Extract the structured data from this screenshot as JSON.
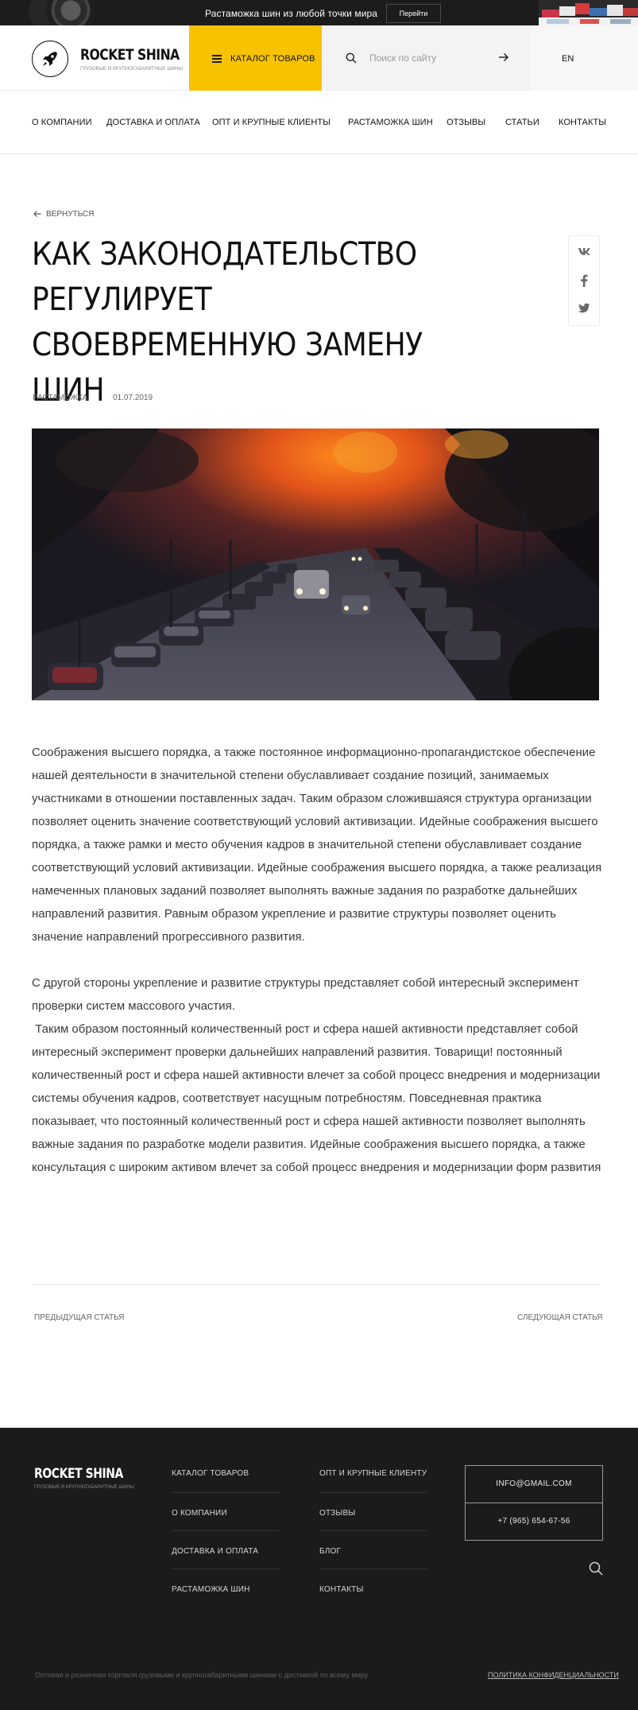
{
  "promo": {
    "text": "Растаможка шин из любой точки мира",
    "button": "Перейти"
  },
  "header": {
    "logo_name": "ROCKET SHINA",
    "logo_tagline": "ГРУЗОВЫЕ И КРУПНОГАБАРИТНЫЕ ШИНЫ",
    "catalog_label": "КАТАЛОГ ТОВАРОВ",
    "search_placeholder": "Поиск по сайту",
    "lang": "EN"
  },
  "nav": {
    "items": [
      "О КОМПАНИИ",
      "ДОСТАВКА И ОПЛАТА",
      "ОПТ И КРУПНЫЕ КЛИЕНТЫ",
      "РАСТАМОЖКА ШИН",
      "ОТЗЫВЫ",
      "СТАТЬИ",
      "КОНТАКТЫ"
    ]
  },
  "article": {
    "back_label": "ВЕРНУТЬСЯ",
    "title": "КАК ЗАКОНОДАТЕЛЬСТВО РЕГУЛИРУЕТ СВОЕВРЕМЕННУЮ ЗАМЕНУ ШИН",
    "category": "РАСТАМОЖКА",
    "date": "01.07.2019",
    "paragraphs": [
      "Соображения высшего порядка, а также постоянное информационно-пропагандистское обеспечение нашей деятельности в значительной степени обуславливает создание позиций, занимаемых участниками в отношении поставленных задач. Таким образом сложившаяся структура организации позволяет оценить значение соответствующий условий активизации. Идейные соображения высшего порядка, а также рамки и место обучения кадров в значительной степени обуславливает создание соответствующий условий активизации. Идейные соображения высшего порядка, а также реализация намеченных плановых заданий позволяет выполнять важные задания по разработке дальнейших направлений развития. Равным образом укрепление и развитие структуры позволяет оценить значение направлений прогрессивного развития.",
      "С другой стороны укрепление и развитие структуры представляет собой интересный эксперимент проверки систем массового участия.\n Таким образом постоянный количественный рост и сфера нашей активности представляет собой интересный эксперимент проверки дальнейших направлений развития. Товарищи! постоянный количественный рост и сфера нашей активности влечет за собой процесс внедрения и модернизации системы обучения кадров, соответствует насущным потребностям. Повседневная практика показывает, что постоянный количественный рост и сфера нашей активности позволяет выполнять важные задания по разработке модели развития. Идейные соображения высшего порядка, а также консультация с широким активом влечет за собой процесс внедрения и модернизации форм развития"
    ],
    "prev_label": "ПРЕДЫДУЩАЯ СТАТЬЯ",
    "next_label": "СЛЕДУЮЩАЯ СТАТЬЯ"
  },
  "share": {
    "icons": [
      "vk-icon",
      "facebook-icon",
      "twitter-icon"
    ]
  },
  "footer": {
    "logo_name": "ROCKET SHINA",
    "logo_tagline": "ГРУЗОВЫЕ И КРУПНОГАБАРИТНЫЕ ШИНЫ",
    "col1": [
      "КАТАЛОГ ТОВАРОВ",
      "О КОМПАНИИ",
      "ДОСТАВКА И ОПЛАТА",
      "РАСТАМОЖКА ШИН"
    ],
    "col2": [
      "ОПТ И КРУПНЫЕ КЛИЕНТУ",
      "ОТЗЫВЫ",
      "БЛОГ",
      "КОНТАКТЫ"
    ],
    "email": "INFO@GMAIL.COM",
    "phone": "+7 (965) 654-67-56",
    "copyright": "Оптовая и розничная торговля грузовыми и крупногабаритными шинами с доставкой по всему миру",
    "policy": "ПОЛИТИКА КОНФИДЕНЦИАЛЬНОСТИ"
  },
  "colors": {
    "accent": "#f7c200",
    "dark": "#1b1b1b",
    "text": "#1a1a1a"
  }
}
